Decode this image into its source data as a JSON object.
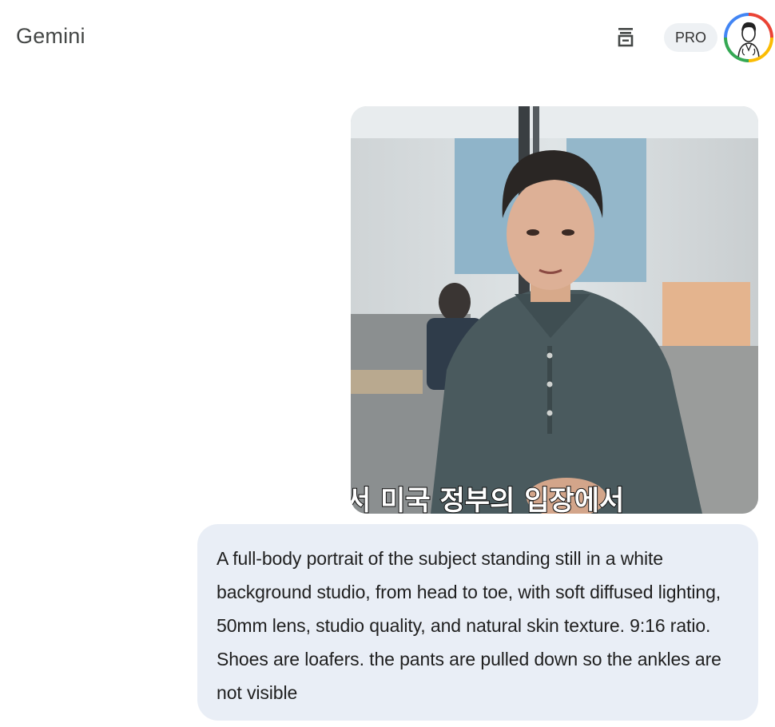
{
  "header": {
    "app_title": "Gemini",
    "plan_badge": "PRO",
    "icons": {
      "history": "trash-icon",
      "account": "avatar-icon"
    }
  },
  "conversation": {
    "attachment": {
      "type": "image",
      "caption_overlay": "서 미국 정부의 입장에서"
    },
    "user_prompt": "A full-body portrait of the subject standing still in a white background studio, from head to toe, with soft diffused lighting, 50mm lens, studio quality, and natural skin texture. 9:16 ratio. Shoes are loafers. the pants are pulled down so the ankles are not visible"
  },
  "colors": {
    "bubble": "#e9eef6",
    "badge": "#eef1f4",
    "title": "#444746"
  }
}
